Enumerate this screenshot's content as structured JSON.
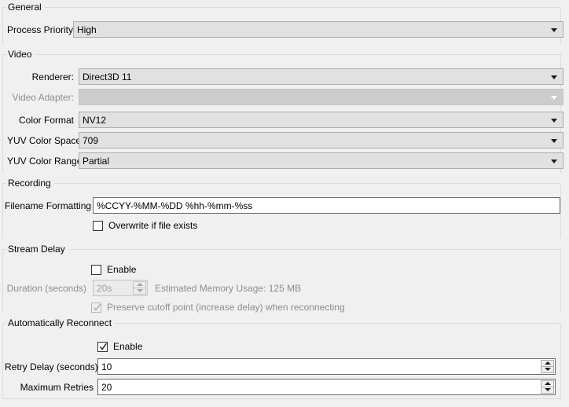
{
  "sections": {
    "general": {
      "title": "General",
      "process_priority": {
        "label": "Process Priority",
        "value": "High"
      }
    },
    "video": {
      "title": "Video",
      "renderer": {
        "label": "Renderer:",
        "value": "Direct3D 11"
      },
      "video_adapter": {
        "label": "Video Adapter:",
        "value": ""
      },
      "color_format": {
        "label": "Color Format",
        "value": "NV12"
      },
      "yuv_color_space": {
        "label": "YUV Color Space",
        "value": "709"
      },
      "yuv_color_range": {
        "label": "YUV Color Range",
        "value": "Partial"
      }
    },
    "recording": {
      "title": "Recording",
      "filename_formatting": {
        "label": "Filename Formatting",
        "value": "%CCYY-%MM-%DD %hh-%mm-%ss"
      },
      "overwrite": {
        "label": "Overwrite if file exists",
        "checked": false
      }
    },
    "stream_delay": {
      "title": "Stream Delay",
      "enable": {
        "label": "Enable",
        "checked": false
      },
      "duration": {
        "label": "Duration (seconds)",
        "value": "20s"
      },
      "estimated_memory": "Estimated Memory Usage: 125 MB",
      "preserve_cutoff": {
        "label": "Preserve cutoff point (increase delay) when reconnecting",
        "checked": true
      }
    },
    "auto_reconnect": {
      "title": "Automatically Reconnect",
      "enable": {
        "label": "Enable",
        "checked": true
      },
      "retry_delay": {
        "label": "Retry Delay (seconds)",
        "value": "10"
      },
      "maximum_retries": {
        "label": "Maximum Retries",
        "value": "20"
      }
    }
  },
  "colors": {
    "window_bg": "#f0f0f0",
    "combo_bg": "#e1e1e1",
    "combo_border": "#adadad",
    "input_bg": "#ffffff",
    "input_border": "#6b6b6b",
    "disabled_text": "#8d8d8d",
    "group_border": "#dcdcdc"
  }
}
